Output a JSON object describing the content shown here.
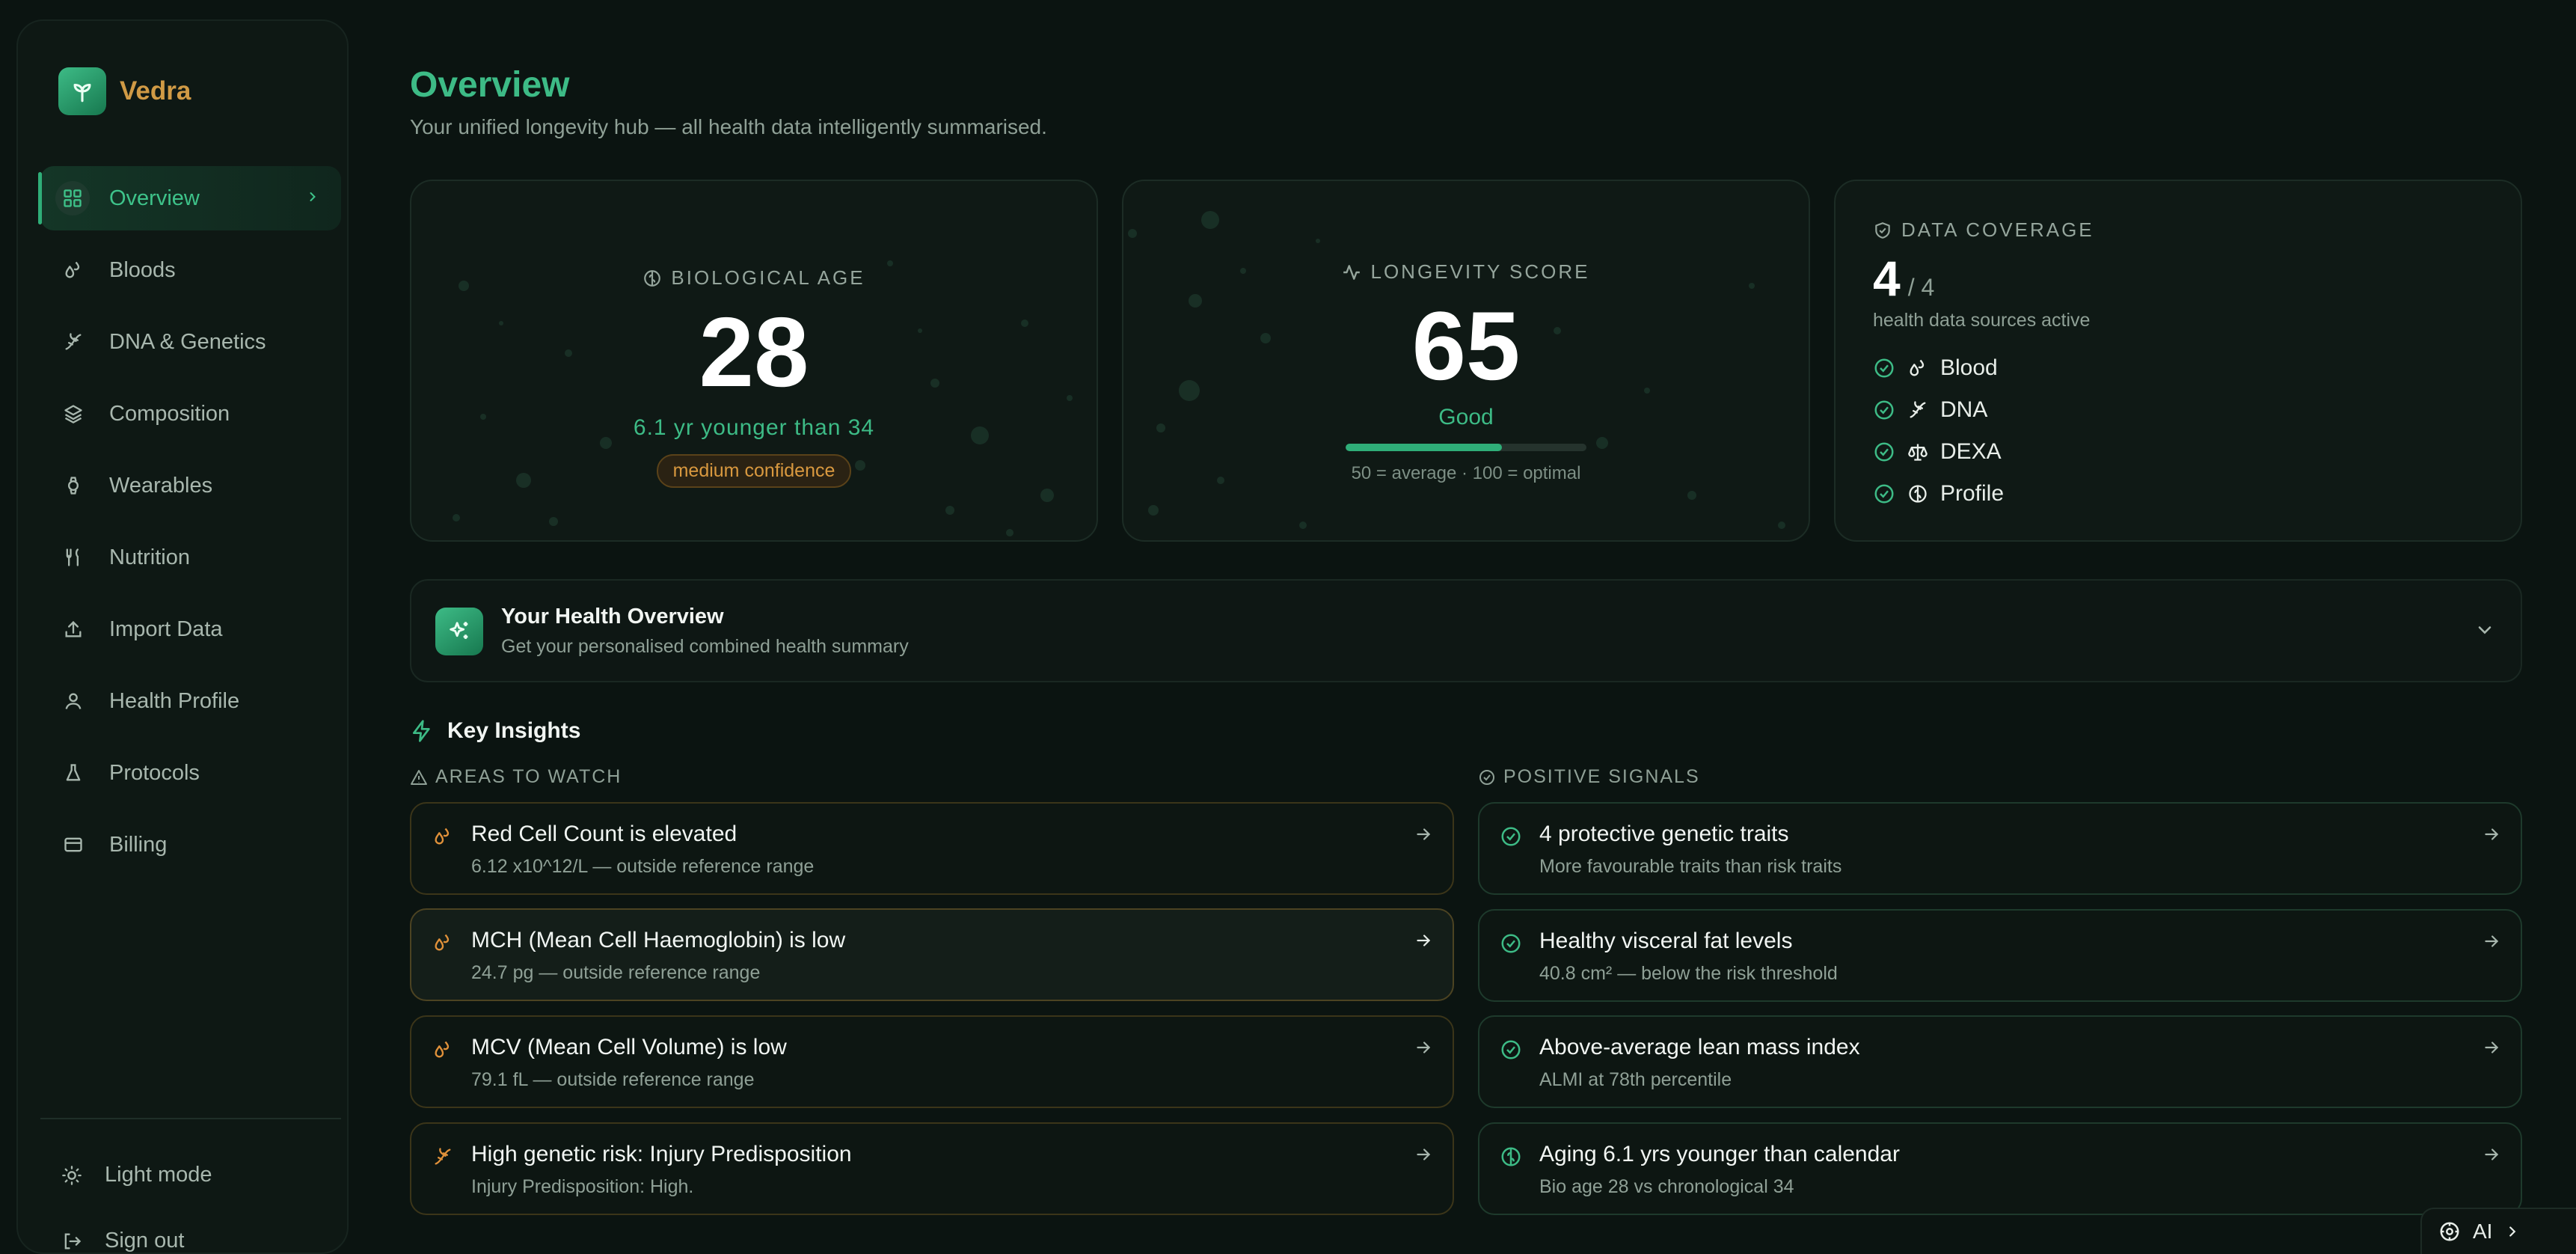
{
  "brand": {
    "name": "Vedra"
  },
  "sidebar": {
    "items": [
      {
        "label": "Overview",
        "icon": "grid-icon",
        "active": true
      },
      {
        "label": "Bloods",
        "icon": "drops-icon"
      },
      {
        "label": "DNA & Genetics",
        "icon": "dna-icon"
      },
      {
        "label": "Composition",
        "icon": "layers-icon"
      },
      {
        "label": "Wearables",
        "icon": "watch-icon"
      },
      {
        "label": "Nutrition",
        "icon": "utensils-icon"
      },
      {
        "label": "Import Data",
        "icon": "upload-icon"
      },
      {
        "label": "Health Profile",
        "icon": "user-icon"
      },
      {
        "label": "Protocols",
        "icon": "flask-icon"
      },
      {
        "label": "Billing",
        "icon": "card-icon"
      }
    ],
    "light_mode": "Light mode",
    "sign_out": "Sign out"
  },
  "header": {
    "title": "Overview",
    "subtitle": "Your unified longevity hub — all health data intelligently summarised."
  },
  "bio_age": {
    "label": "BIOLOGICAL AGE",
    "value": "28",
    "subtitle": "6.1 yr younger than 34",
    "badge": "medium confidence"
  },
  "longevity": {
    "label": "LONGEVITY SCORE",
    "value": "65",
    "rating": "Good",
    "progress": 0.65,
    "note": "50 = average · 100 = optimal"
  },
  "coverage": {
    "label": "DATA COVERAGE",
    "count": "4",
    "total": "/ 4",
    "description": "health data sources active",
    "sources": [
      {
        "label": "Blood",
        "icon": "drops-icon"
      },
      {
        "label": "DNA",
        "icon": "dna-icon"
      },
      {
        "label": "DEXA",
        "icon": "scale-icon"
      },
      {
        "label": "Profile",
        "icon": "brain-icon"
      }
    ]
  },
  "health_overview": {
    "title": "Your Health Overview",
    "subtitle": "Get your personalised combined health summary"
  },
  "insights": {
    "title": "Key Insights",
    "watch_label": "AREAS TO WATCH",
    "positive_label": "POSITIVE SIGNALS",
    "watch": [
      {
        "title": "Red Cell Count is elevated",
        "detail": "6.12 x10^12/L — outside reference range",
        "icon": "drops-icon"
      },
      {
        "title": "MCH (Mean Cell Haemoglobin) is low",
        "detail": "24.7 pg — outside reference range",
        "icon": "drops-icon"
      },
      {
        "title": "MCV (Mean Cell Volume) is low",
        "detail": "79.1 fL — outside reference range",
        "icon": "drops-icon"
      },
      {
        "title": "High genetic risk: Injury Predisposition",
        "detail": "Injury Predisposition: High.",
        "icon": "dna-icon"
      }
    ],
    "positive": [
      {
        "title": "4 protective genetic traits",
        "detail": "More favourable traits than risk traits",
        "icon": "check-circle-icon"
      },
      {
        "title": "Healthy visceral fat levels",
        "detail": "40.8 cm² — below the risk threshold",
        "icon": "check-circle-icon"
      },
      {
        "title": "Above-average lean mass index",
        "detail": "ALMI at 78th percentile",
        "icon": "check-circle-icon"
      },
      {
        "title": "Aging 6.1 yrs younger than calendar",
        "detail": "Bio age 28 vs chronological 34",
        "icon": "brain-icon"
      }
    ]
  },
  "ai_button": {
    "label": "AI"
  },
  "colors": {
    "accent": "#3dbb86",
    "warning": "#e0913a",
    "background": "#0b1411",
    "brand_name": "#d09a45"
  }
}
